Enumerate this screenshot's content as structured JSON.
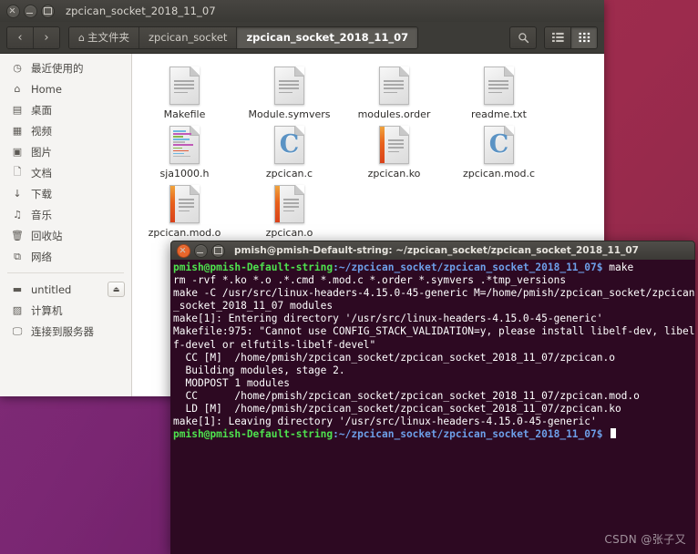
{
  "desktop": {
    "left_color": "#77216f",
    "right_color": "#9c2b4d",
    "watermark": "CSDN @张子又"
  },
  "file_manager": {
    "window_title": "zpcican_socket_2018_11_07",
    "window_controls": [
      {
        "name": "close",
        "label": "×"
      },
      {
        "name": "minimize",
        "label": "–"
      },
      {
        "name": "maximize",
        "label": "□"
      }
    ],
    "nav": {
      "back_label": "‹",
      "forward_label": "›"
    },
    "breadcrumbs": [
      {
        "label": "主文件夹",
        "icon": "home-icon",
        "active": false
      },
      {
        "label": "zpcican_socket",
        "active": false
      },
      {
        "label": "zpcican_socket_2018_11_07",
        "active": true
      }
    ],
    "toolbar_right": {
      "search_icon": "search-icon",
      "list_view_icon": "list-view-icon",
      "grid_view_icon": "grid-view-icon",
      "active_view": "grid"
    },
    "sidebar": {
      "group_1": [
        {
          "label": "最近使用的",
          "icon": "clock-icon"
        },
        {
          "label": "Home",
          "icon": "home-icon"
        },
        {
          "label": "桌面",
          "icon": "desktop-folder-icon"
        },
        {
          "label": "视频",
          "icon": "video-icon"
        },
        {
          "label": "图片",
          "icon": "camera-icon"
        },
        {
          "label": "文档",
          "icon": "document-icon"
        },
        {
          "label": "下载",
          "icon": "download-icon"
        },
        {
          "label": "音乐",
          "icon": "music-icon"
        },
        {
          "label": "回收站",
          "icon": "trash-icon"
        },
        {
          "label": "网络",
          "icon": "network-icon"
        }
      ],
      "group_2": [
        {
          "label": "untitled",
          "icon": "drive-icon",
          "eject": true,
          "eject_label": "⏏"
        },
        {
          "label": "计算机",
          "icon": "computer-icon",
          "eject": false
        },
        {
          "label": "连接到服务器",
          "icon": "server-connect-icon",
          "eject": false
        }
      ]
    },
    "files": [
      [
        {
          "name": "Makefile",
          "icon": "text-document-icon"
        },
        {
          "name": "Module.symvers",
          "icon": "text-document-icon"
        },
        {
          "name": "modules.order",
          "icon": "text-document-icon"
        },
        {
          "name": "readme.txt",
          "icon": "text-document-icon"
        }
      ],
      [
        {
          "name": "sja1000.h",
          "icon": "c-header-document-icon"
        },
        {
          "name": "zpcican.c",
          "icon": "c-source-document-icon"
        },
        {
          "name": "zpcican.ko",
          "icon": "binary-document-icon"
        },
        {
          "name": "zpcican.mod.c",
          "icon": "c-source-document-icon"
        }
      ],
      [
        {
          "name": "zpcican.mod.o",
          "icon": "binary-document-icon"
        },
        {
          "name": "zpcican.o",
          "icon": "binary-document-icon"
        }
      ]
    ]
  },
  "terminal": {
    "window_title": "pmish@pmish-Default-string: ~/zpcican_socket/zpcican_socket_2018_11_07",
    "window_controls": [
      {
        "name": "close",
        "label": "×"
      },
      {
        "name": "minimize",
        "label": "–"
      },
      {
        "name": "maximize",
        "label": "□"
      }
    ],
    "prompt_user": "pmish@pmish-Default-string",
    "prompt_path": ":~/zpcican_socket/zpcican_socket_2018_11_07$",
    "lines": [
      {
        "type": "prompt",
        "command": " make"
      },
      {
        "type": "out",
        "text": "rm -rvf *.ko *.o .*.cmd *.mod.c *.order *.symvers .*tmp_versions"
      },
      {
        "type": "out",
        "text": "make -C /usr/src/linux-headers-4.15.0-45-generic M=/home/pmish/zpcican_socket/zpcican"
      },
      {
        "type": "out",
        "text": "_socket_2018_11_07 modules"
      },
      {
        "type": "out",
        "text": "make[1]: Entering directory '/usr/src/linux-headers-4.15.0-45-generic'"
      },
      {
        "type": "out",
        "text": "Makefile:975: \"Cannot use CONFIG_STACK_VALIDATION=y, please install libelf-dev, libel"
      },
      {
        "type": "out",
        "text": "f-devel or elfutils-libelf-devel\""
      },
      {
        "type": "out",
        "text": "  CC [M]  /home/pmish/zpcican_socket/zpcican_socket_2018_11_07/zpcican.o"
      },
      {
        "type": "out",
        "text": "  Building modules, stage 2."
      },
      {
        "type": "out",
        "text": "  MODPOST 1 modules"
      },
      {
        "type": "out",
        "text": "  CC      /home/pmish/zpcican_socket/zpcican_socket_2018_11_07/zpcican.mod.o"
      },
      {
        "type": "out",
        "text": "  LD [M]  /home/pmish/zpcican_socket/zpcican_socket_2018_11_07/zpcican.ko"
      },
      {
        "type": "out",
        "text": "make[1]: Leaving directory '/usr/src/linux-headers-4.15.0-45-generic'"
      },
      {
        "type": "prompt",
        "command": " ",
        "cursor": true
      }
    ]
  }
}
